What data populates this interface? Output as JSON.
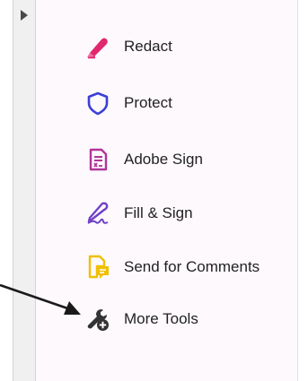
{
  "tools_panel": {
    "items": [
      {
        "label": "Redact",
        "icon": "redact-marker-icon",
        "color": "#e0286e"
      },
      {
        "label": "Protect",
        "icon": "shield-icon",
        "color": "#3b3fd8"
      },
      {
        "label": "Adobe Sign",
        "icon": "document-sign-icon",
        "color": "#b1359a"
      },
      {
        "label": "Fill & Sign",
        "icon": "pen-signature-icon",
        "color": "#7040c8"
      },
      {
        "label": "Send for Comments",
        "icon": "document-comment-icon",
        "color": "#f0c000"
      },
      {
        "label": "More Tools",
        "icon": "wrench-add-icon",
        "color": "#333333"
      }
    ]
  },
  "colors": {
    "pane_background": "#fdf9fd",
    "strip_background": "#f0f0f0",
    "annotation_arrow": "#1a1a1a"
  }
}
